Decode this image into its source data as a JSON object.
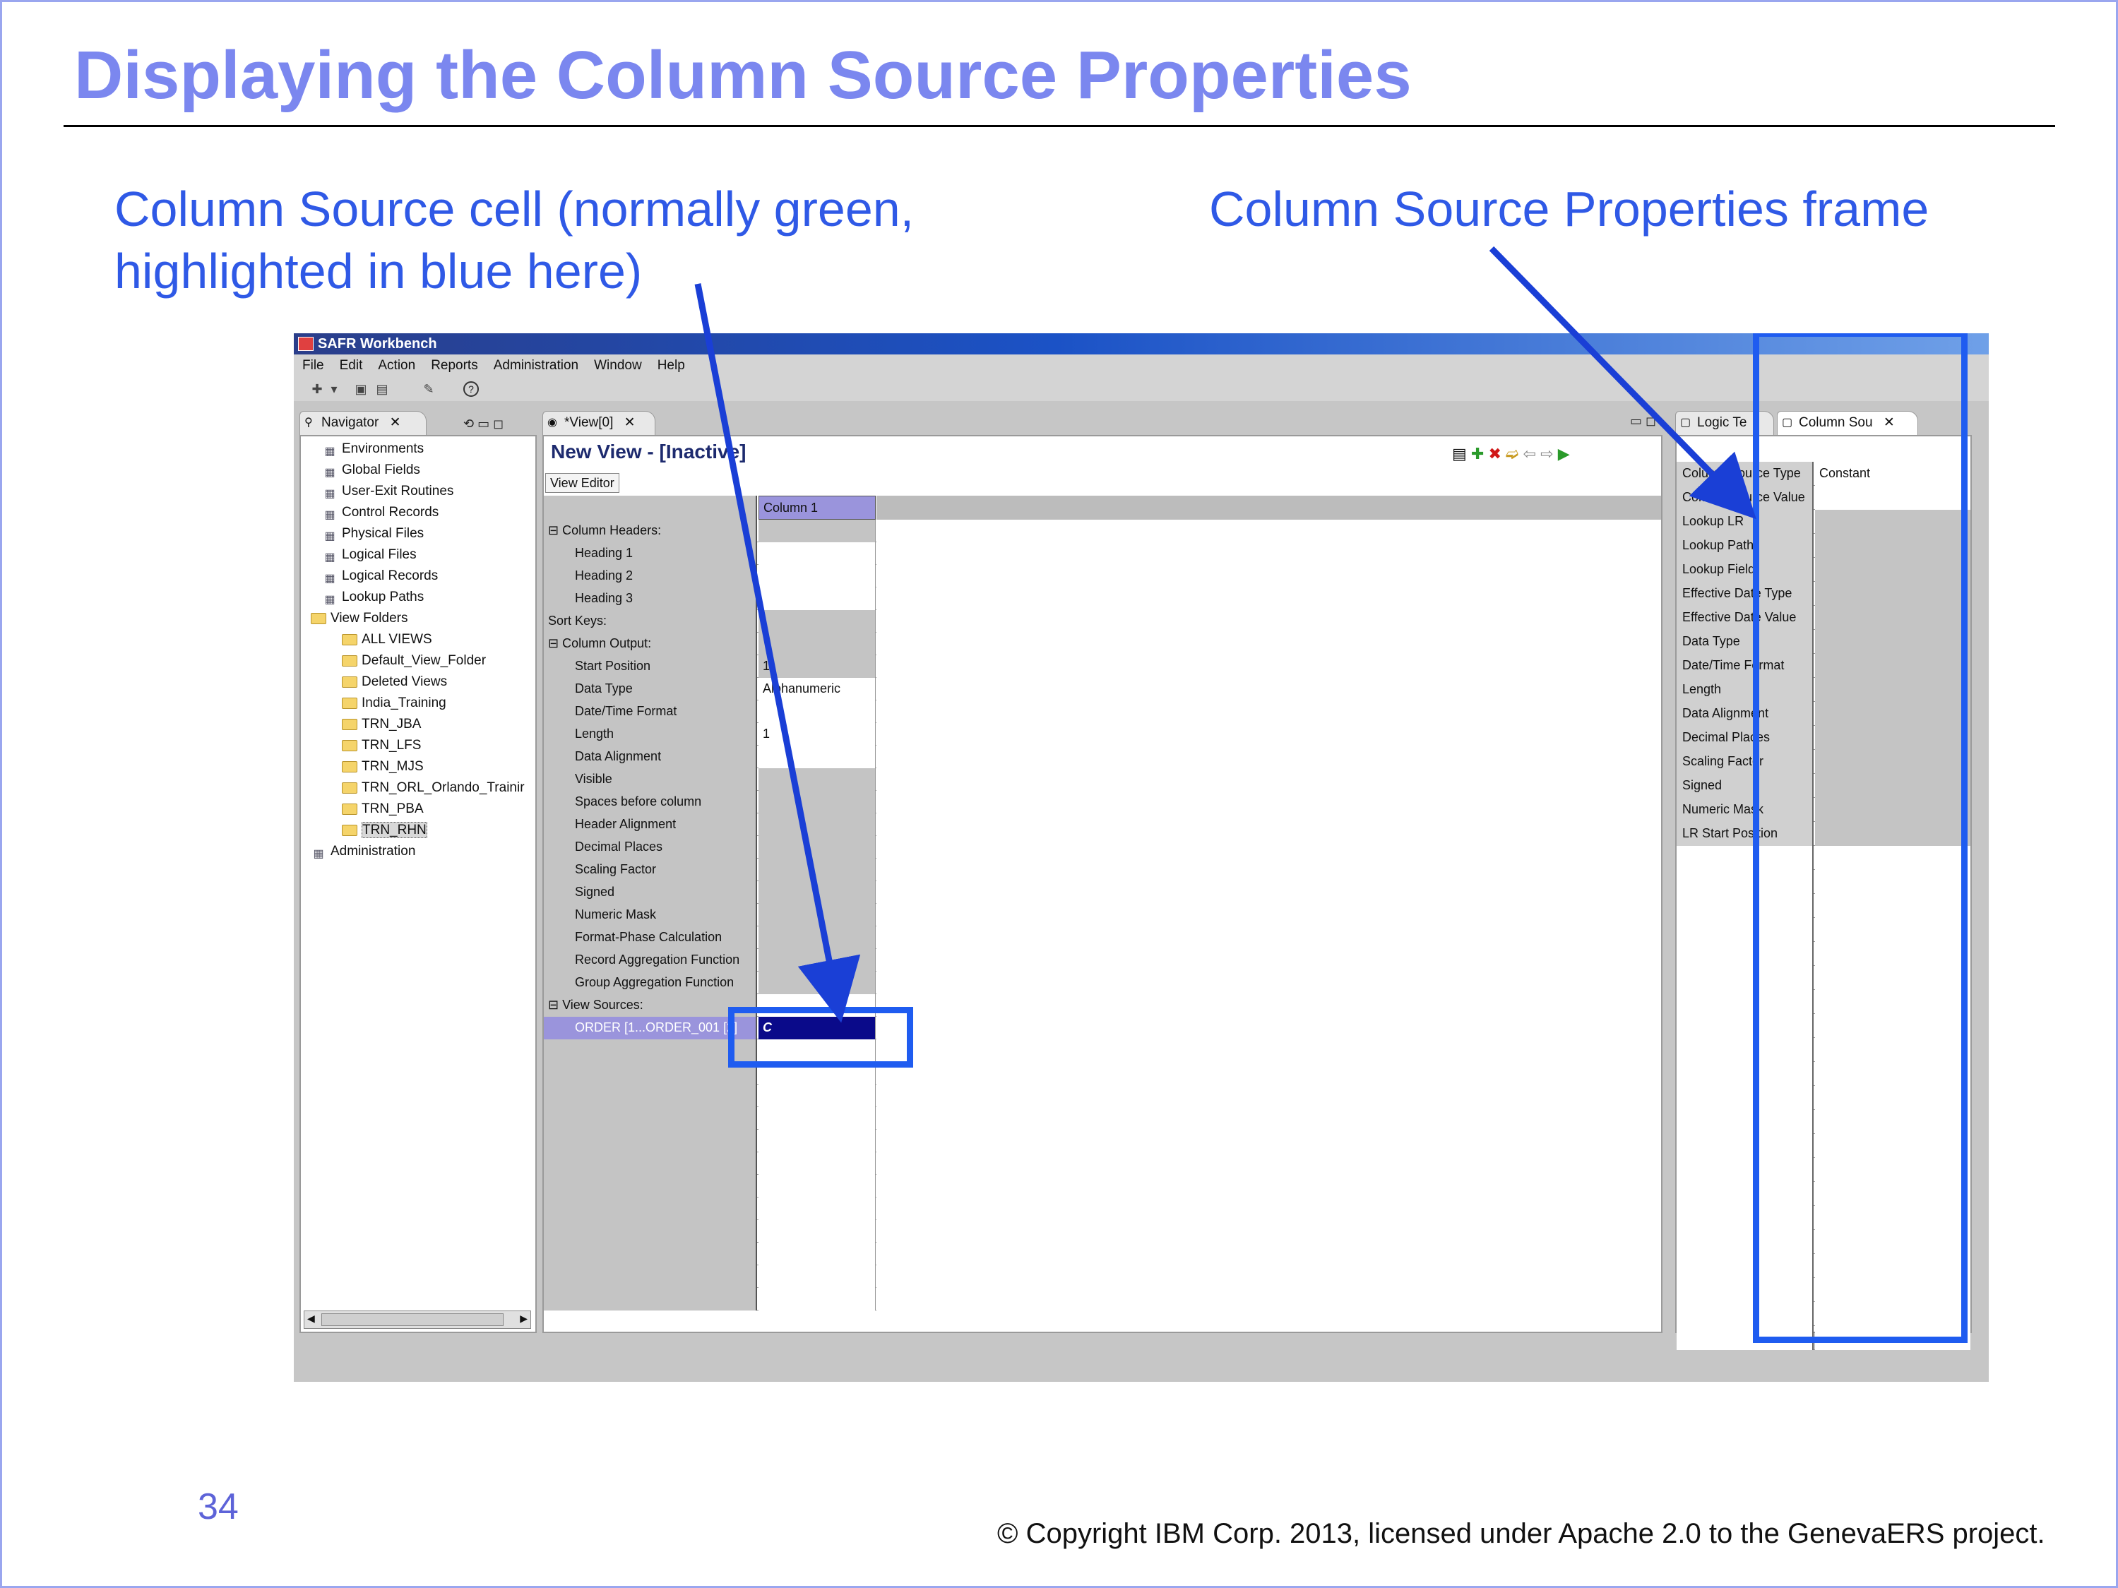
{
  "slide": {
    "title": "Displaying the Column Source Properties",
    "callout_left_line1": "Column Source cell (normally green,",
    "callout_left_line2": "highlighted in blue here)",
    "callout_right": "Column Source Properties frame",
    "page_number": "34",
    "copyright": "© Copyright IBM Corp. 2013, licensed under Apache 2.0 to the GenevaERS project."
  },
  "app": {
    "window_title": "SAFR Workbench",
    "menu": [
      "File",
      "Edit",
      "Action",
      "Reports",
      "Administration",
      "Window",
      "Help"
    ]
  },
  "navigator": {
    "tab_label": "Navigator",
    "items": [
      {
        "label": "Environments",
        "icon": "environments-icon"
      },
      {
        "label": "Global Fields",
        "icon": "global-fields-icon"
      },
      {
        "label": "User-Exit Routines",
        "icon": "user-exit-icon"
      },
      {
        "label": "Control Records",
        "icon": "control-records-icon"
      },
      {
        "label": "Physical Files",
        "icon": "physical-files-icon"
      },
      {
        "label": "Logical Files",
        "icon": "logical-files-icon"
      },
      {
        "label": "Logical Records",
        "icon": "logical-records-icon"
      },
      {
        "label": "Lookup Paths",
        "icon": "lookup-paths-icon"
      },
      {
        "label": "View Folders",
        "icon": "folder-icon"
      },
      {
        "label": "ALL VIEWS",
        "icon": "folder-icon"
      },
      {
        "label": "Default_View_Folder",
        "icon": "folder-icon"
      },
      {
        "label": "Deleted Views",
        "icon": "folder-icon"
      },
      {
        "label": "India_Training",
        "icon": "folder-icon"
      },
      {
        "label": "TRN_JBA",
        "icon": "folder-icon"
      },
      {
        "label": "TRN_LFS",
        "icon": "folder-icon"
      },
      {
        "label": "TRN_MJS",
        "icon": "folder-icon"
      },
      {
        "label": "TRN_ORL_Orlando_Trainir",
        "icon": "folder-icon"
      },
      {
        "label": "TRN_PBA",
        "icon": "folder-icon"
      },
      {
        "label": "TRN_RHN",
        "icon": "folder-icon"
      },
      {
        "label": "Administration",
        "icon": "administration-icon"
      }
    ]
  },
  "editor": {
    "tab_label": "*View[0]",
    "heading": "New View - [Inactive]",
    "subtab": "View Editor",
    "column_header": "Column 1",
    "rows": [
      {
        "label": "⊟ Column Headers:",
        "value": ""
      },
      {
        "label": "Heading 1",
        "value": ""
      },
      {
        "label": "Heading 2",
        "value": ""
      },
      {
        "label": "Heading 3",
        "value": ""
      },
      {
        "label": "Sort Keys:",
        "value": ""
      },
      {
        "label": "⊟ Column Output:",
        "value": ""
      },
      {
        "label": "Start Position",
        "value": "1"
      },
      {
        "label": "Data Type",
        "value": "Alphanumeric"
      },
      {
        "label": "Date/Time Format",
        "value": ""
      },
      {
        "label": "Length",
        "value": "1"
      },
      {
        "label": "Data Alignment",
        "value": ""
      },
      {
        "label": "Visible",
        "value": ""
      },
      {
        "label": "Spaces before column",
        "value": ""
      },
      {
        "label": "Header Alignment",
        "value": ""
      },
      {
        "label": "Decimal Places",
        "value": ""
      },
      {
        "label": "Scaling Factor",
        "value": ""
      },
      {
        "label": "Signed",
        "value": ""
      },
      {
        "label": "Numeric Mask",
        "value": ""
      },
      {
        "label": "Format-Phase Calculation",
        "value": ""
      },
      {
        "label": "Record Aggregation Function",
        "value": ""
      },
      {
        "label": "Group Aggregation Function",
        "value": ""
      },
      {
        "label": "⊟ View Sources:",
        "value": ""
      },
      {
        "label": "ORDER [1...ORDER_001 [2]",
        "value": "C"
      }
    ]
  },
  "properties": {
    "tab_logic": "Logic Te",
    "tab_column_source": "Column Sou",
    "rows": [
      {
        "label": "Column Source Type",
        "value": "Constant"
      },
      {
        "label": "Column Source Value",
        "value": ""
      },
      {
        "label": "Lookup LR",
        "value": ""
      },
      {
        "label": "Lookup Path",
        "value": ""
      },
      {
        "label": "Lookup Field",
        "value": ""
      },
      {
        "label": "Effective Date Type",
        "value": ""
      },
      {
        "label": "Effective Date Value",
        "value": ""
      },
      {
        "label": "Data Type",
        "value": ""
      },
      {
        "label": "Date/Time Format",
        "value": ""
      },
      {
        "label": "Length",
        "value": ""
      },
      {
        "label": "Data Alignment",
        "value": ""
      },
      {
        "label": "Decimal Places",
        "value": ""
      },
      {
        "label": "Scaling Factor",
        "value": ""
      },
      {
        "label": "Signed",
        "value": ""
      },
      {
        "label": "Numeric Mask",
        "value": ""
      },
      {
        "label": "LR Start Position",
        "value": ""
      }
    ]
  },
  "colors": {
    "title": "#7b87ef",
    "callout": "#2f59e6",
    "highlight": "#1f5cf0",
    "selected_cell": "#0a0a8a"
  }
}
